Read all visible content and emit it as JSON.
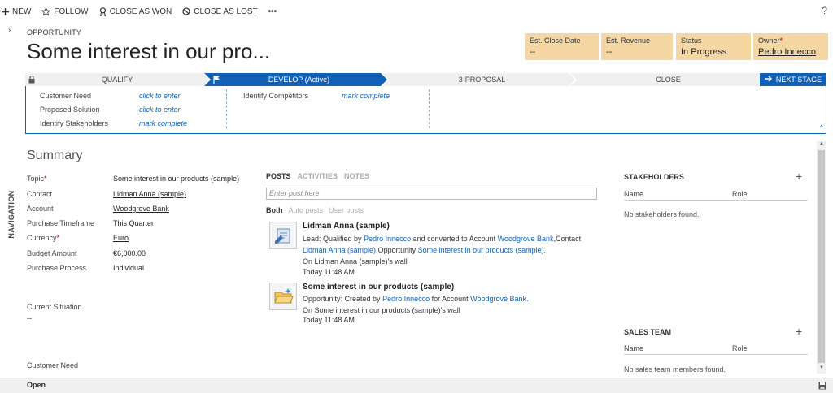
{
  "command_bar": {
    "new": "NEW",
    "follow": "FOLLOW",
    "close_won": "CLOSE AS WON",
    "close_lost": "CLOSE AS LOST",
    "more": "•••",
    "help": "?"
  },
  "header": {
    "nav_chevron": "›",
    "entity": "OPPORTUNITY",
    "title": "Some interest in our pro...",
    "fields": [
      {
        "label": "Est. Close Date",
        "value": "--"
      },
      {
        "label": "Est. Revenue",
        "value": "--"
      },
      {
        "label": "Status",
        "value": "In Progress"
      },
      {
        "label": "Owner",
        "required": "*",
        "value": "Pedro Innecco"
      }
    ]
  },
  "process": {
    "stages": [
      "QUALIFY",
      "DEVELOP (Active)",
      "3-PROPOSAL",
      "CLOSE"
    ],
    "next_stage": "NEXT STAGE",
    "steps": [
      {
        "label": "Customer Need",
        "action": "click to enter"
      },
      {
        "label": "Proposed Solution",
        "action": "click to enter"
      },
      {
        "label": "Identify Stakeholders",
        "action": "mark complete"
      },
      {
        "label": "Identify Competitors",
        "action": "mark complete"
      }
    ],
    "collapse": "^"
  },
  "summary": {
    "title": "Summary",
    "fields": [
      {
        "label": "Topic",
        "required": "*",
        "value": "Some interest in our products (sample)"
      },
      {
        "label": "Contact",
        "value": "Lidman Anna (sample)"
      },
      {
        "label": "Account",
        "value": "Woodgrove Bank"
      },
      {
        "label": "Purchase Timeframe",
        "value": "This Quarter"
      },
      {
        "label": "Currency",
        "required": "*",
        "value": "Euro"
      },
      {
        "label": "Budget Amount",
        "value": "€6,000.00"
      },
      {
        "label": "Purchase Process",
        "value": "Individual"
      }
    ],
    "current_situation_label": "Current Situation",
    "current_situation_value": "--",
    "customer_need_label": "Customer Need"
  },
  "navigation_label": "NAVIGATION",
  "posts": {
    "tabs": [
      "POSTS",
      "ACTIVITIES",
      "NOTES"
    ],
    "input_placeholder": "Enter post here",
    "filters": [
      "Both",
      "Auto posts",
      "User posts"
    ],
    "items": [
      {
        "title": "Lidman Anna (sample)",
        "line1_a": "Lead: Qualified by ",
        "line1_link1": "Pedro Innecco",
        "line1_b": " and converted to Account ",
        "line1_link2": "Woodgrove Bank",
        "line1_c": ",Contact",
        "line2_link1": "Lidman Anna (sample)",
        "line2_a": ",Opportunity ",
        "line2_link2": "Some interest in our products (sample)",
        "line2_b": ".",
        "wall": "On Lidman Anna (sample)'s wall",
        "time": "Today 11:48 AM"
      },
      {
        "title": "Some interest in our products (sample)",
        "line1_a": "Opportunity: Created by ",
        "line1_link1": "Pedro Innecco",
        "line1_b": " for Account ",
        "line1_link2": "Woodgrove Bank",
        "line1_c": ".",
        "wall": "On Some interest in our products (sample)'s wall",
        "time": "Today 11:48 AM"
      }
    ]
  },
  "stakeholders": {
    "title": "STAKEHOLDERS",
    "add": "+",
    "col_name": "Name",
    "col_role": "Role",
    "empty": "No stakeholders found."
  },
  "sales_team": {
    "title": "SALES TEAM",
    "add": "+",
    "col_name": "Name",
    "col_role": "Role",
    "empty": "No sales team members found."
  },
  "footer": {
    "status": "Open"
  },
  "colors": {
    "accent": "#1160b7",
    "header_field": "#f4d7a3"
  }
}
